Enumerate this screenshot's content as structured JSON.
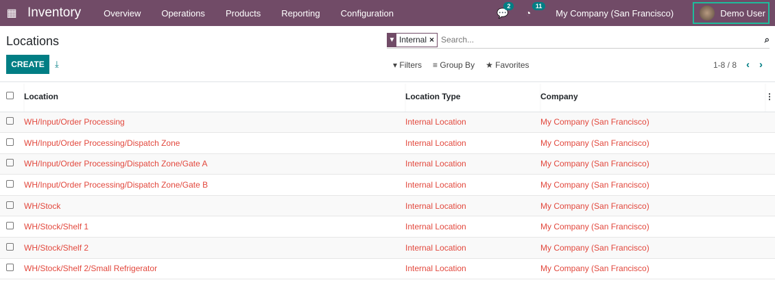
{
  "nav": {
    "app": "Inventory",
    "menus": [
      "Overview",
      "Operations",
      "Products",
      "Reporting",
      "Configuration"
    ],
    "messages_count": "2",
    "activities_count": "11",
    "company": "My Company (San Francisco)",
    "user": "Demo User"
  },
  "page": {
    "title": "Locations",
    "create": "CREATE",
    "search_facet": "Internal",
    "search_placeholder": "Search...",
    "filters": "Filters",
    "group_by": "Group By",
    "favorites": "Favorites",
    "pager": "1-8 / 8"
  },
  "columns": [
    "Location",
    "Location Type",
    "Company"
  ],
  "rows": [
    {
      "location": "WH/Input/Order Processing",
      "type": "Internal Location",
      "company": "My Company (San Francisco)"
    },
    {
      "location": "WH/Input/Order Processing/Dispatch Zone",
      "type": "Internal Location",
      "company": "My Company (San Francisco)"
    },
    {
      "location": "WH/Input/Order Processing/Dispatch Zone/Gate A",
      "type": "Internal Location",
      "company": "My Company (San Francisco)"
    },
    {
      "location": "WH/Input/Order Processing/Dispatch Zone/Gate B",
      "type": "Internal Location",
      "company": "My Company (San Francisco)"
    },
    {
      "location": "WH/Stock",
      "type": "Internal Location",
      "company": "My Company (San Francisco)"
    },
    {
      "location": "WH/Stock/Shelf 1",
      "type": "Internal Location",
      "company": "My Company (San Francisco)"
    },
    {
      "location": "WH/Stock/Shelf 2",
      "type": "Internal Location",
      "company": "My Company (San Francisco)"
    },
    {
      "location": "WH/Stock/Shelf 2/Small Refrigerator",
      "type": "Internal Location",
      "company": "My Company (San Francisco)"
    }
  ]
}
